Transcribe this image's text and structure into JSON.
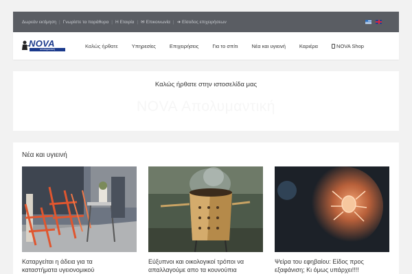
{
  "topbar": {
    "links": [
      {
        "label": "Δωρεάν εκτίμηση"
      },
      {
        "label": "Γνωρίστε τα παράθυρα"
      },
      {
        "label": "Η Εταιρία"
      },
      {
        "label": "Επικοινωνία",
        "icon": "envelope-icon"
      },
      {
        "label": "Είσοδος επιχειρήσεων",
        "icon": "sign-in-icon"
      }
    ],
    "languages": [
      "el",
      "en"
    ],
    "background": "#5a5d63"
  },
  "logo": {
    "text": "NOVA",
    "subtitle": "απολυμαντική",
    "color": "#1b3a8c"
  },
  "menu": {
    "items": [
      "Καλώς ήρθατε",
      "Υπηρεσίες",
      "Επιχειρήσεις",
      "Για το σπίτι",
      "Νέα και υγιεινή",
      "Καριέρα",
      "NOVA Shop"
    ]
  },
  "welcome": {
    "line": "Καλώς ήρθατε στην ιστοσελίδα μας",
    "ghost": "NOVA Απολυμαντική"
  },
  "news": {
    "title": "Νέα και υγιεινή",
    "articles": [
      {
        "line1": "Καταργείται η άδεια για τα",
        "line2": "καταστήματα υγειονομικού"
      },
      {
        "line1": "Εύξυπνοι και οικολογικοί τρόποι να",
        "line2": "απαλλαγούμε απο τα κουνούπια"
      },
      {
        "line1": "Ψείρα του εφηβαίου: Είδος προς",
        "line2": "εξαφάνιση; Κι όμως υπάρχει!!!!"
      }
    ]
  }
}
